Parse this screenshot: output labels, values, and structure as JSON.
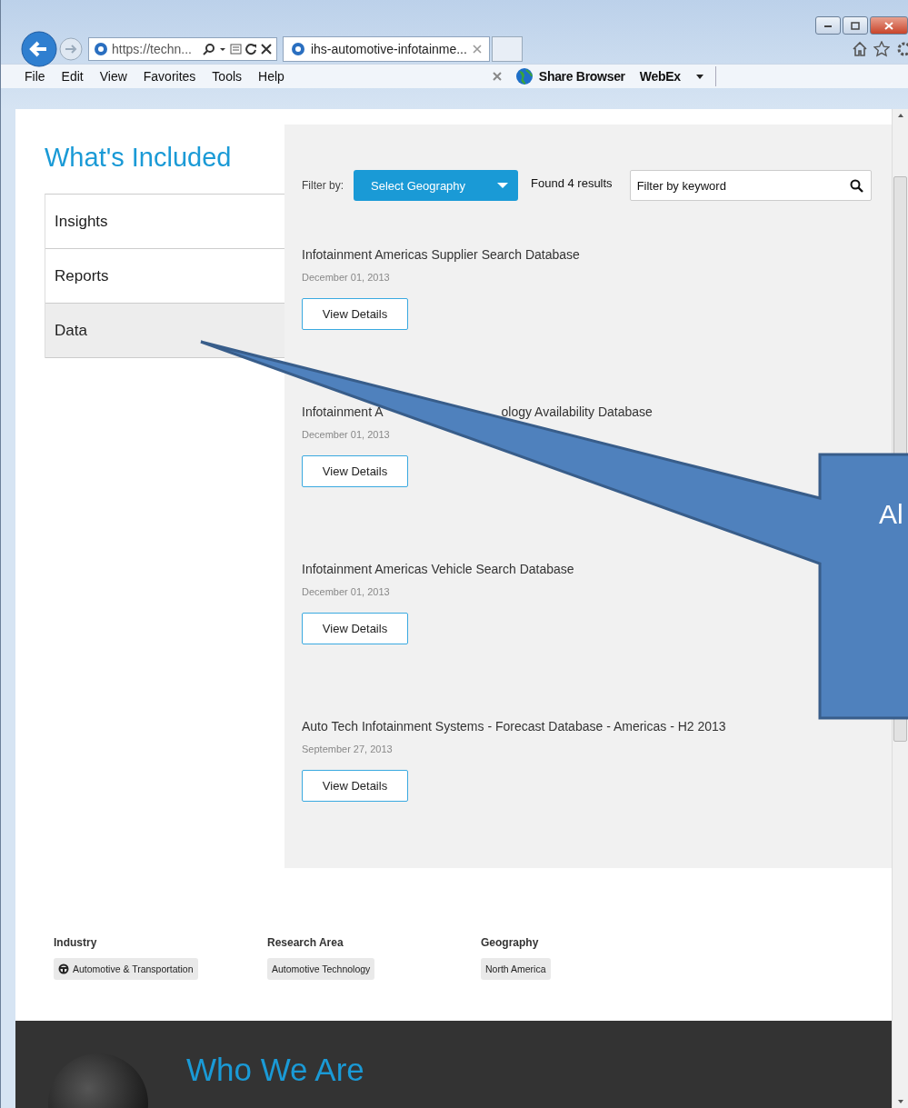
{
  "browser": {
    "address": "https://techn...",
    "tabs": [
      {
        "label": "ihs-automotive-infotainme...",
        "selected": true
      }
    ],
    "menu": [
      "File",
      "Edit",
      "View",
      "Favorites",
      "Tools",
      "Help"
    ],
    "share_label": "Share Browser",
    "webex_label": "WebEx"
  },
  "sidebar": {
    "heading": "What's Included",
    "items": [
      {
        "label": "Insights",
        "selected": false
      },
      {
        "label": "Reports",
        "selected": false
      },
      {
        "label": "Data",
        "selected": true
      }
    ]
  },
  "filter": {
    "label": "Filter by:",
    "dropdown": "Select Geography",
    "results": "Found 4 results",
    "search_placeholder": "Filter by keyword"
  },
  "results": [
    {
      "title_parts": [
        "Infotainment Americas Supplier Search Database"
      ],
      "date": "December 01, 2013",
      "button": "View Details"
    },
    {
      "title_parts": [
        "Infotainment A",
        "ology Availability Database"
      ],
      "date": "December 01, 2013",
      "button": "View Details"
    },
    {
      "title_parts": [
        "Infotainment Americas Vehicle Search Database"
      ],
      "date": "December 01, 2013",
      "button": "View Details"
    },
    {
      "title_parts": [
        "Auto Tech Infotainment Systems - Forecast Database - Americas - H2 2013"
      ],
      "date": "September 27, 2013",
      "button": "View Details"
    }
  ],
  "facets": [
    {
      "heading": "Industry",
      "tags": [
        {
          "label": "Automotive & Transportation",
          "kind": "icon"
        }
      ]
    },
    {
      "heading": "Research Area",
      "tags": [
        {
          "label": "Automotive Technology",
          "kind": "plain"
        }
      ]
    },
    {
      "heading": "Geography",
      "tags": [
        {
          "label": "North America",
          "kind": "plain"
        }
      ]
    }
  ],
  "footer": {
    "heading": "Who We Are"
  },
  "callout": {
    "text": "Al"
  }
}
